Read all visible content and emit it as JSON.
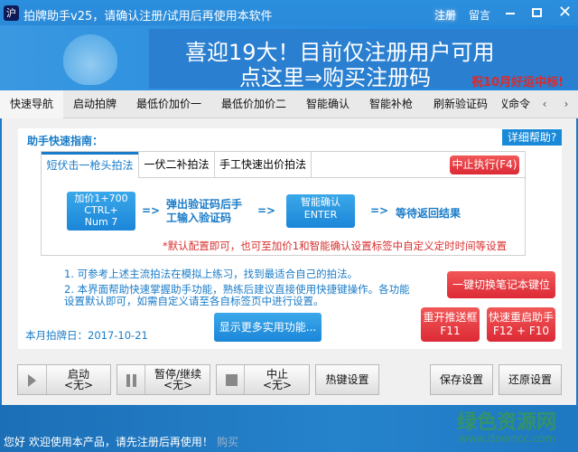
{
  "window": {
    "title": "拍牌助手v25，请确认注册/试用后再使用本软件",
    "icon_text": "沪",
    "register": "注册",
    "message": "留言"
  },
  "banner": {
    "line1": "喜迎19大！目前仅注册用户可用",
    "line2": "点这里⇒购买注册码",
    "wish": "祝10月好运中标!"
  },
  "tabs": [
    {
      "label": "快速导航"
    },
    {
      "label": "启动拍牌"
    },
    {
      "label": "最低价加价一"
    },
    {
      "label": "最低价加价二"
    },
    {
      "label": "智能确认"
    },
    {
      "label": "智能补枪"
    },
    {
      "label": "刷新验证码"
    },
    {
      "label": "议命令"
    }
  ],
  "guide": {
    "title": "助手快速指南：",
    "help": "详细帮助?",
    "subtabs": [
      {
        "label": "短伏击一枪头拍法"
      },
      {
        "label": "一伏二补拍法"
      },
      {
        "label": "手工快速出价拍法"
      }
    ],
    "stop_exec": "中止执行(F4)",
    "step1": [
      "加价1+700",
      "CTRL+",
      "Num 7"
    ],
    "arrow": "=>",
    "step2": [
      "弹出验证码后手",
      "工输入验证码"
    ],
    "step3": [
      "智能确认",
      "ENTER"
    ],
    "step4": "等待返回结果",
    "note": "*默认配置即可，也可至加价1和智能确认设置标签中自定义定时时间等设置",
    "tip1": "1. 可参考上述主流拍法在模拟上练习，找到最适合自己的拍法。",
    "tip2a": "2. 本界面帮助快速掌握助手功能，熟练后建议直接使用快捷键操作。各功能",
    "tip2b": "设置默认即可，如需自定义请至各自标签页中进行设置。",
    "switch_keys": "一键切换笔记本键位",
    "reopen": [
      "重开推送框",
      "F11"
    ],
    "restart": [
      "快速重启助手",
      "F12 + F10"
    ],
    "more": "显示更多实用功能...",
    "date_label": "本月拍牌日：",
    "date": "2017-10-21"
  },
  "toolbar": {
    "start": "启动",
    "pause": "暂停/继续",
    "stop": "中止",
    "none": "<无>",
    "hotkey": "热键设置",
    "save": "保存设置",
    "restore": "还原设置"
  },
  "status": {
    "text": "您好 欢迎使用本产品，请先注册后再使用！",
    "buy": "购买",
    "watermark": "绿色资源网",
    "watermark_url": "www.downcc.com"
  }
}
